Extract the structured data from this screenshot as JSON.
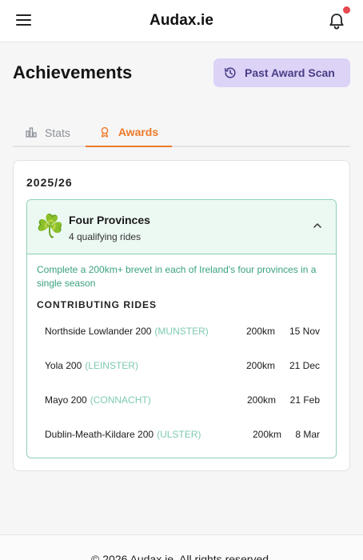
{
  "header": {
    "brand": "Audax.ie",
    "icons": {
      "menu": "menu-icon",
      "notifications": "bell-icon"
    },
    "accent": "#e5484d"
  },
  "page": {
    "title": "Achievements",
    "scan_button": "Past Award Scan"
  },
  "tabs": [
    {
      "label": "Stats",
      "icon": "bar-chart-icon",
      "active": false
    },
    {
      "label": "Awards",
      "icon": "award-icon",
      "active": true
    }
  ],
  "season": "2025/26",
  "award": {
    "icon": "☘️",
    "name": "Four Provinces",
    "subtitle": "4 qualifying rides",
    "description": "Complete a 200km+ brevet in each of Ireland's four provinces in a single season",
    "contributing_label": "CONTRIBUTING RIDES",
    "rides": [
      {
        "name": "Northside Lowlander 200",
        "province": "(MUNSTER)",
        "distance": "200km",
        "date": "15 Nov"
      },
      {
        "name": "Yola 200",
        "province": "(LEINSTER)",
        "distance": "200km",
        "date": "21 Dec"
      },
      {
        "name": "Mayo 200",
        "province": "(CONNACHT)",
        "distance": "200km",
        "date": "21 Feb"
      },
      {
        "name": "Dublin-Meath-Kildare 200",
        "province": "(ULSTER)",
        "distance": "200km",
        "date": "8 Mar"
      }
    ]
  },
  "footer": {
    "text": "© 2026 Audax.ie. All rights reserved."
  },
  "colors": {
    "accent_orange": "#ee7a2a",
    "award_green": "#3aa180",
    "scan_button_bg": "#dcd3f7"
  }
}
